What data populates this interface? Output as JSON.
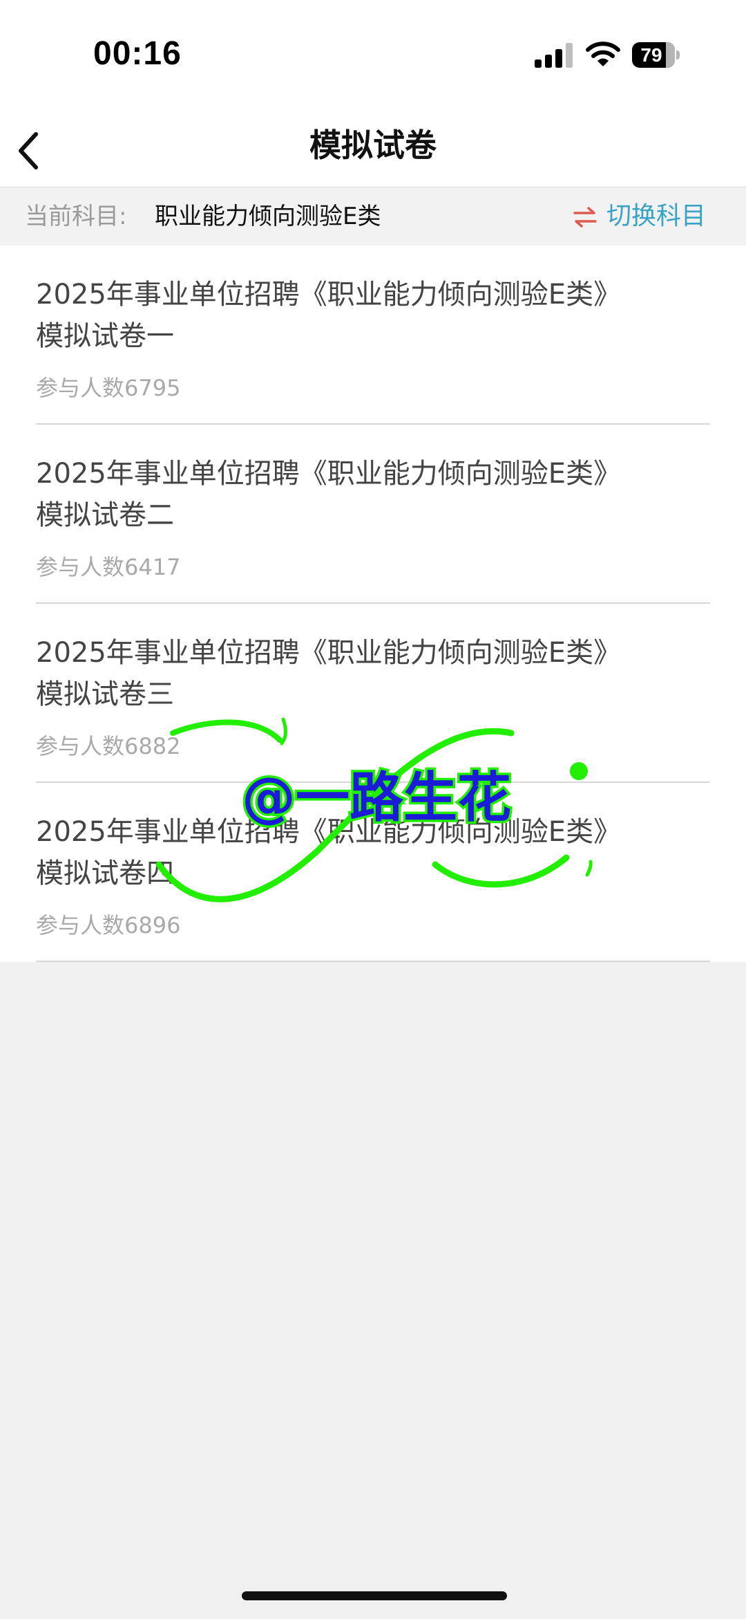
{
  "status_bar": {
    "time": "00:16",
    "battery_level": "79",
    "icons": [
      "signal-icon",
      "wifi-icon",
      "battery-icon"
    ]
  },
  "nav": {
    "title": "模拟试卷",
    "back_icon": "chevron-left-icon"
  },
  "subject_bar": {
    "label": "当前科目:",
    "value": "职业能力倾向测验E类",
    "switch_icon": "swap-arrows-icon",
    "switch_label": "切换科目"
  },
  "papers": [
    {
      "title": "2025年事业单位招聘《职业能力倾向测验E类》模拟试卷一",
      "count": "参与人数6795"
    },
    {
      "title": "2025年事业单位招聘《职业能力倾向测验E类》模拟试卷二",
      "count": "参与人数6417"
    },
    {
      "title": "2025年事业单位招聘《职业能力倾向测验E类》模拟试卷三",
      "count": "参与人数6882"
    },
    {
      "title": "2025年事业单位招聘《职业能力倾向测验E类》模拟试卷四",
      "count": "参与人数6896"
    }
  ],
  "watermark": {
    "text": "@一路生花"
  },
  "colors": {
    "accent": "#3aa3c4",
    "switch_icon": "#e05a4f",
    "watermark_stroke": "#22ee00",
    "watermark_fill": "#1b1bd8"
  }
}
